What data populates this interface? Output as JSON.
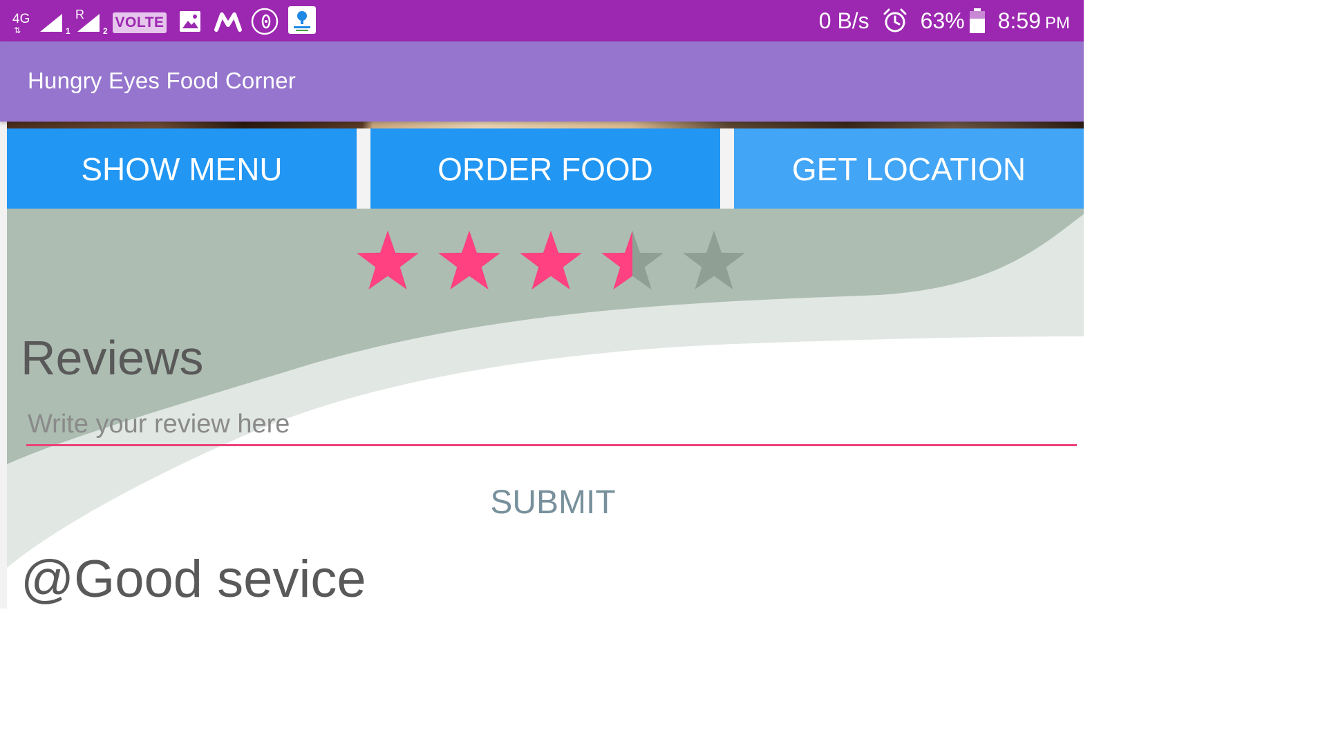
{
  "status_bar": {
    "network_type": "4G",
    "network_arrows": "⇅",
    "sim1_index": "1",
    "sim2_roaming": "R",
    "sim2_index": "2",
    "volte": "VOLTE",
    "data_speed": "0 B/s",
    "battery": "63%",
    "time": "8:59",
    "ampm": "PM",
    "icons": [
      "signal-icon",
      "signal-icon",
      "gallery-icon",
      "myntra-icon",
      "music-icon",
      "aryakosh-app-icon",
      "alarm-icon",
      "battery-icon"
    ]
  },
  "app_bar": {
    "title": "Hungry Eyes Food Corner"
  },
  "actions": {
    "show_menu": "SHOW MENU",
    "order_food": "ORDER FOOD",
    "get_location": "GET LOCATION"
  },
  "rating": {
    "value": 3.5,
    "max": 5,
    "filled_color": "#ff4081",
    "empty_color": "#8f9f94"
  },
  "reviews": {
    "heading": "Reviews",
    "input_placeholder": "Write your review here",
    "input_value": "",
    "submit_label": "SUBMIT",
    "entries": [
      "@Good sevice"
    ]
  },
  "colors": {
    "status_bar": "#9c27b0",
    "app_bar": "#9575cd",
    "button": "#2196f3",
    "button_light": "#42a5f5",
    "accent": "#ec407a"
  }
}
